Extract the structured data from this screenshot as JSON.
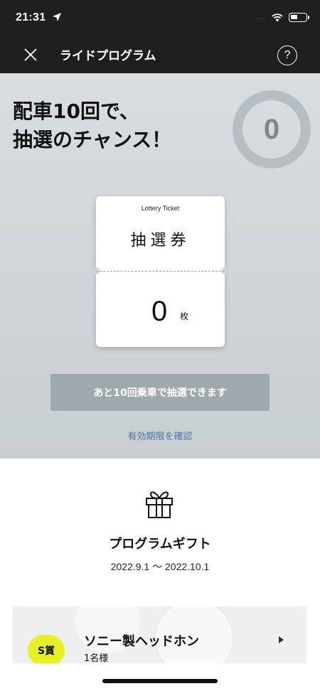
{
  "status_bar": {
    "time": "21:31",
    "location_icon": "location-arrow-icon",
    "signal": "....",
    "wifi_icon": "wifi-icon",
    "battery_icon": "battery-icon"
  },
  "nav": {
    "close_icon": "close-icon",
    "title": "ライドプログラム",
    "help_label": "?"
  },
  "hero": {
    "headline_line1": "配車10回で、",
    "headline_line2": "抽選のチャンス！",
    "ride_count": "0",
    "ticket": {
      "label": "Lottery Ticket",
      "name": "抽選券",
      "count": "0",
      "unit": "枚"
    },
    "cta_label": "あと10回乗車で抽選できます",
    "expiry_link": "有効期限を確認"
  },
  "gift": {
    "icon": "gift-icon",
    "title": "プログラムギフト",
    "period": "2022.9.1 〜 2022.10.1"
  },
  "prizes": [
    {
      "badge": "S賞",
      "name": "ソニー製ヘッドホン",
      "count": "1名様"
    }
  ],
  "colors": {
    "topbar": "#1f1f1f",
    "hero_bg": "#cfd5d8",
    "cta_bg": "#9fa8ac",
    "link": "#4a76a8",
    "badge": "#e7ef26"
  }
}
